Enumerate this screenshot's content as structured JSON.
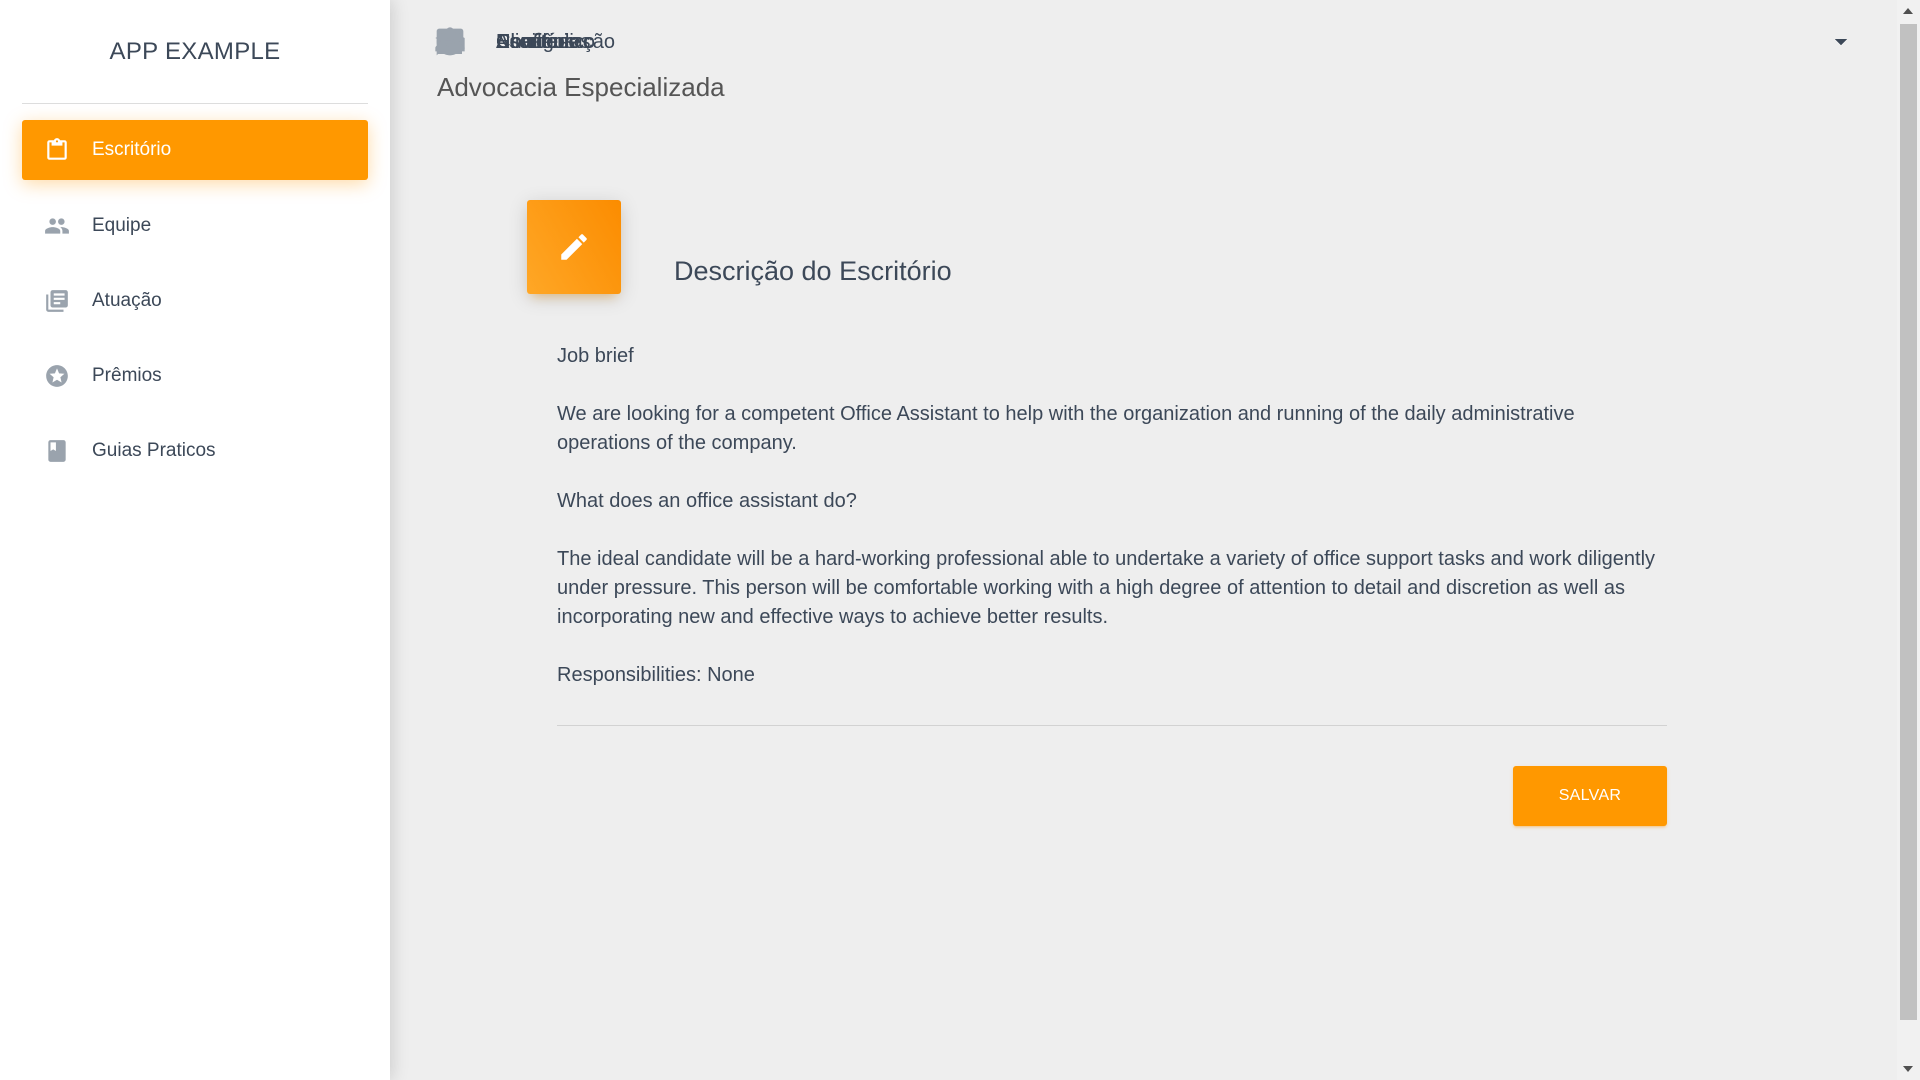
{
  "app": {
    "title": "APP EXAMPLE"
  },
  "sidebar": {
    "items": [
      {
        "label": "Novidades",
        "icon": "dashboard-icon",
        "expandable": false
      },
      {
        "label": "Acadêmico",
        "icon": "school-icon",
        "expandable": true
      },
      {
        "label": "Escritório",
        "icon": "clipboard-icon",
        "expandable": true
      },
      {
        "label": "Escritório",
        "icon": "clipboard-icon",
        "active": true,
        "sub": true
      },
      {
        "label": "Equipe",
        "icon": "people-icon",
        "sub": true
      },
      {
        "label": "Atuação",
        "icon": "library-books-icon",
        "sub": true
      },
      {
        "label": "Prêmios",
        "icon": "stars-icon",
        "sub": true
      },
      {
        "label": "Guias Praticos",
        "icon": "book-icon",
        "sub": true
      },
      {
        "label": "Chat",
        "icon": "chat-icon",
        "expandable": false
      },
      {
        "label": "Clientes",
        "icon": "dollar-icon",
        "expandable": true
      },
      {
        "label": "Usuários",
        "icon": "people-icon",
        "expandable": false
      },
      {
        "label": "Configuração",
        "icon": "gear-icon",
        "expandable": true
      }
    ]
  },
  "main": {
    "page_title": "Advocacia Especializada",
    "card": {
      "icon": "pencil-icon",
      "title": "Descrição do Escritório",
      "paragraphs": [
        "Job brief",
        "We are looking for a competent Office Assistant to help with the organization and running of the daily administrative operations of the company.",
        "What does an office assistant do?",
        "The ideal candidate will be a hard-working professional able to undertake a variety of office support tasks and work diligently under pressure. This person will be comfortable working with a high degree of attention to detail and discretion as well as incorporating new and effective ways to achieve better results.",
        "Responsibilities: None"
      ],
      "save_label": "SALVAR"
    }
  },
  "colors": {
    "accent": "#ff9800",
    "background": "#eeeeee",
    "sidebar": "#ffffff",
    "text": "#3c4858"
  }
}
